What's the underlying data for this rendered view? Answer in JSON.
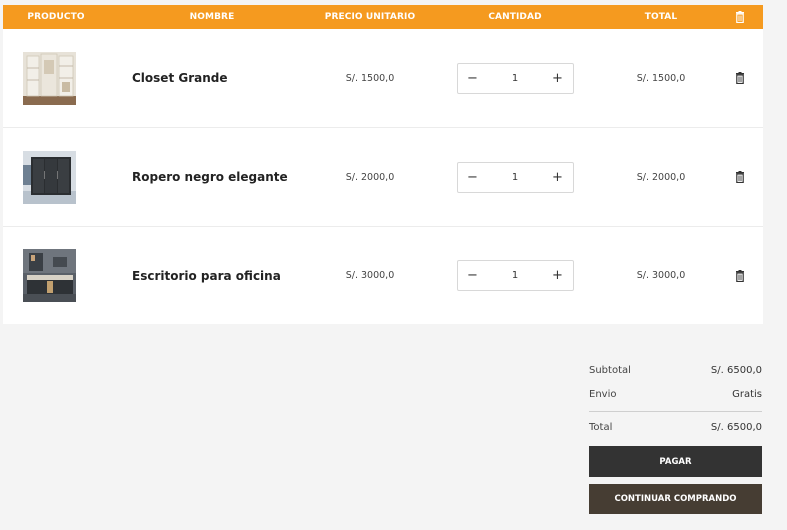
{
  "table": {
    "headers": {
      "product": "PRODUCTO",
      "name": "NOMBRE",
      "unit_price": "PRECIO UNITARIO",
      "quantity": "CANTIDAD",
      "total": "TOTAL",
      "delete_icon": "trash-icon"
    },
    "rows": [
      {
        "image_icon": "closet-image",
        "name": "Closet Grande",
        "unit_price": "S/. 1500,0",
        "quantity": "1",
        "total": "S/. 1500,0"
      },
      {
        "image_icon": "wardrobe-image",
        "name": "Ropero negro elegante",
        "unit_price": "S/. 2000,0",
        "quantity": "1",
        "total": "S/. 2000,0"
      },
      {
        "image_icon": "desk-image",
        "name": "Escritorio para oficina",
        "unit_price": "S/. 3000,0",
        "quantity": "1",
        "total": "S/. 3000,0"
      }
    ],
    "stepper": {
      "minus": "−",
      "plus": "+"
    }
  },
  "summary": {
    "subtotal_label": "Subtotal",
    "subtotal_value": "S/. 6500,0",
    "shipping_label": "Envio",
    "shipping_value": "Gratis",
    "total_label": "Total",
    "total_value": "S/. 6500,0"
  },
  "actions": {
    "pay_label": "PAGAR",
    "continue_label": "CONTINUAR COMPRANDO"
  },
  "colors": {
    "header_bg": "#f59a1f",
    "pay_bg": "#333333",
    "continue_bg": "#463d33",
    "page_bg": "#f4f4f4"
  }
}
